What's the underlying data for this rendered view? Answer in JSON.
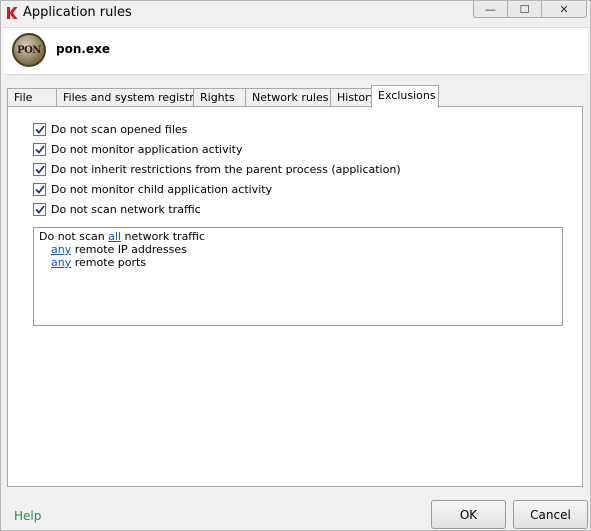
{
  "window": {
    "title": "Application rules",
    "minimize_glyph": "—",
    "maximize_glyph": "☐",
    "close_glyph": "✕"
  },
  "header": {
    "app_name": "pon.exe",
    "logo_text": "PON"
  },
  "tabs": [
    {
      "label": "File"
    },
    {
      "label": "Files and system registry"
    },
    {
      "label": "Rights"
    },
    {
      "label": "Network rules"
    },
    {
      "label": "History"
    },
    {
      "label": "Exclusions",
      "active": true
    }
  ],
  "options": [
    {
      "label": "Do not scan opened files",
      "checked": true
    },
    {
      "label": "Do not monitor application activity",
      "checked": true
    },
    {
      "label": "Do not inherit restrictions from the parent process (application)",
      "checked": true
    },
    {
      "label": "Do not monitor child application activity",
      "checked": true
    },
    {
      "label": "Do not scan network traffic",
      "checked": true
    }
  ],
  "rule": {
    "line1_prefix": "Do not scan ",
    "line1_link": "all",
    "line1_suffix": " network traffic",
    "line2_link": "any",
    "line2_suffix": " remote IP addresses",
    "line3_link": "any",
    "line3_suffix": " remote ports"
  },
  "footer": {
    "help": "Help",
    "ok": "OK",
    "cancel": "Cancel"
  },
  "colors": {
    "link": "#1155cc",
    "help": "#2a8a54",
    "brand_red": "#c81e1e"
  }
}
